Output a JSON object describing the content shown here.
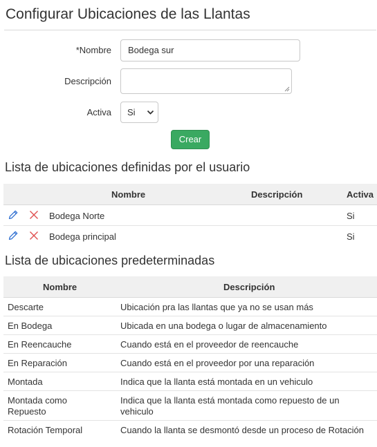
{
  "page": {
    "title": "Configurar Ubicaciones de las Llantas"
  },
  "form": {
    "nombre_label": "*Nombre",
    "nombre_value": "Bodega sur",
    "descripcion_label": "Descripción",
    "descripcion_value": "",
    "activa_label": "Activa",
    "activa_value": "Si",
    "crear_label": "Crear"
  },
  "user_list": {
    "title": "Lista de ubicaciones definidas por el usuario",
    "headers": {
      "nombre": "Nombre",
      "descripcion": "Descripción",
      "activa": "Activa"
    },
    "rows": [
      {
        "nombre": "Bodega Norte",
        "descripcion": "",
        "activa": "Si"
      },
      {
        "nombre": "Bodega principal",
        "descripcion": "",
        "activa": "Si"
      }
    ]
  },
  "default_list": {
    "title": "Lista de ubicaciones predeterminadas",
    "headers": {
      "nombre": "Nombre",
      "descripcion": "Descripción"
    },
    "rows": [
      {
        "nombre": "Descarte",
        "descripcion": "Ubicación pra las llantas que ya no se usan más"
      },
      {
        "nombre": "En Bodega",
        "descripcion": "Ubicada en una bodega o lugar de almacenamiento"
      },
      {
        "nombre": "En Reencauche",
        "descripcion": "Cuando está en el proveedor de reencauche"
      },
      {
        "nombre": "En Reparación",
        "descripcion": "Cuando está en el proveedor por una reparación"
      },
      {
        "nombre": "Montada",
        "descripcion": "Indica que la llanta está montada en un vehiculo"
      },
      {
        "nombre_lines": [
          "Montada como",
          "Repuesto"
        ],
        "descripcion_lines": [
          "Indica que la llanta está montada como repuesto de un",
          "vehiculo"
        ]
      },
      {
        "nombre": "Rotación Temporal",
        "descripcion": "Cuando la llanta se desmontó desde un proceso de Rotación"
      }
    ]
  },
  "icons": {
    "edit": "pencil-icon",
    "delete": "x-icon",
    "dropdown": "chevron-down-icon"
  },
  "colors": {
    "primary": "#3aa961",
    "edit_icon": "#2f6fd1",
    "delete_icon": "#e05151"
  }
}
